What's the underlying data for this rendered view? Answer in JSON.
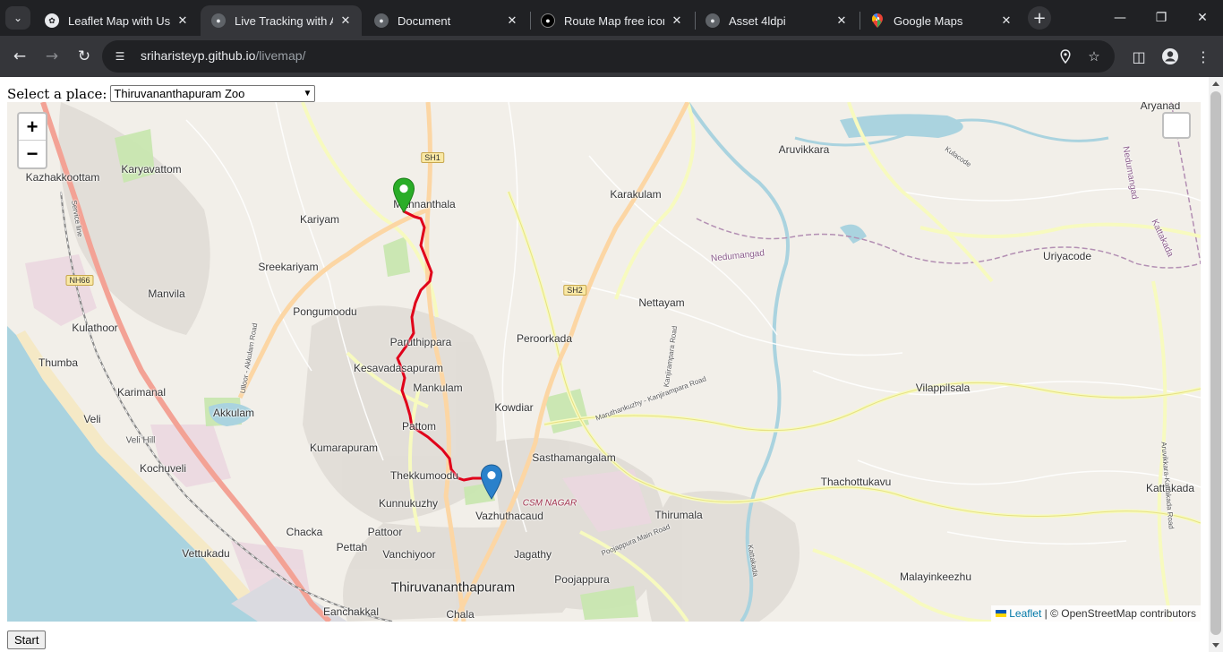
{
  "browser": {
    "tabs": [
      {
        "title": "Leaflet Map with Use",
        "icon": "openai-icon",
        "active": false
      },
      {
        "title": "Live Tracking with Al",
        "icon": "globe-icon",
        "active": true
      },
      {
        "title": "Document",
        "icon": "globe-icon",
        "active": false
      },
      {
        "title": "Route Map free icon",
        "icon": "flaticon-icon",
        "active": false
      },
      {
        "title": "Asset 4ldpi",
        "icon": "globe-icon",
        "active": false
      },
      {
        "title": "Google Maps",
        "icon": "google-maps-icon",
        "active": false
      }
    ],
    "url_host": "sriharisteyp.github.io",
    "url_path": "/livemap/"
  },
  "form": {
    "label": "Select a place:",
    "selected_place": "Thiruvananthapuram Zoo",
    "start_label": "Start"
  },
  "map": {
    "zoom_in": "+",
    "zoom_out": "−",
    "attribution_link": "Leaflet",
    "attribution_text": "| © OpenStreetMap contributors",
    "markers": [
      {
        "name": "start",
        "color": "#2aad27",
        "place": "Mannanthala"
      },
      {
        "name": "destination",
        "color": "#2a81cb",
        "place": "Thiruvananthapuram Zoo"
      }
    ],
    "route_color": "#e0001a",
    "labels": {
      "aryanad": "Aryanad",
      "aruvikkara": "Aruvikkara",
      "karyavattom": "Karyavattom",
      "kazhakkoottam": "Kazhakkoottam",
      "kariyam": "Kariyam",
      "mannanthala": "Mannanthala",
      "karakulam": "Karakulam",
      "sreekariyam": "Sreekariyam",
      "manvila": "Manvila",
      "pongumoodu": "Pongumoodu",
      "kulathoor": "Kulathoor",
      "nettayam": "Nettayam",
      "uriyacode": "Uriyacode",
      "peroorkada": "Peroorkada",
      "paruthippara": "Paruthippara",
      "thumba": "Thumba",
      "kesavadasapuram": "Kesavadasapuram",
      "mankulam": "Mankulam",
      "karimanal": "Karimanal",
      "vilappilsala": "Vilappilsala",
      "kowdiar": "Kowdiar",
      "akkulam": "Akkulam",
      "veli": "Veli",
      "pattom": "Pattom",
      "veli_hill": "Veli Hill",
      "kumarapuram": "Kumarapuram",
      "sasthamangalam": "Sasthamangalam",
      "kochuveli": "Kochuveli",
      "thekkumoodu": "Thekkumoodu",
      "thachottukavu": "Thachottukavu",
      "kattakada": "Kattakada",
      "csm_nagar": "CSM NAGAR",
      "kunnukuzhy": "Kunnukuzhy",
      "vazhuthacaud": "Vazhuthacaud",
      "thirumala": "Thirumala",
      "chacka": "Chacka",
      "pettah": "Pettah",
      "pattoor": "Pattoor",
      "vettukadu": "Vettukadu",
      "vanchiyoor": "Vanchiyoor",
      "jagathy": "Jagathy",
      "poojappura": "Poojappura",
      "malayinkeezhu": "Malayinkeezhu",
      "thiruvananthapuram": "Thiruvananthapuram",
      "eanchakkal": "Eanchakkal",
      "chala": "Chala",
      "nedumangad": "Nedumangad",
      "nedumangad_road": "Nedumangad",
      "kattakada_road": "Kattakada",
      "kulacode": "Kulacode",
      "aruvikkara_kattakada_road": "Aruvikkara-Kattakada Road",
      "kanjirampara_road": "Kanjirampara Road",
      "maruthankuzhy_road": "Maruthankuzhy - Kanjirampara Road",
      "poojappura_main_road": "Poojappura Main Road",
      "ulloor_akkulam_road": "Ulloor - Akkulam Road",
      "service_line": "Service line",
      "kattakada_side": "Kattakada"
    },
    "shields": {
      "sh1": "SH1",
      "sh2": "SH2",
      "nh66": "NH66"
    }
  }
}
